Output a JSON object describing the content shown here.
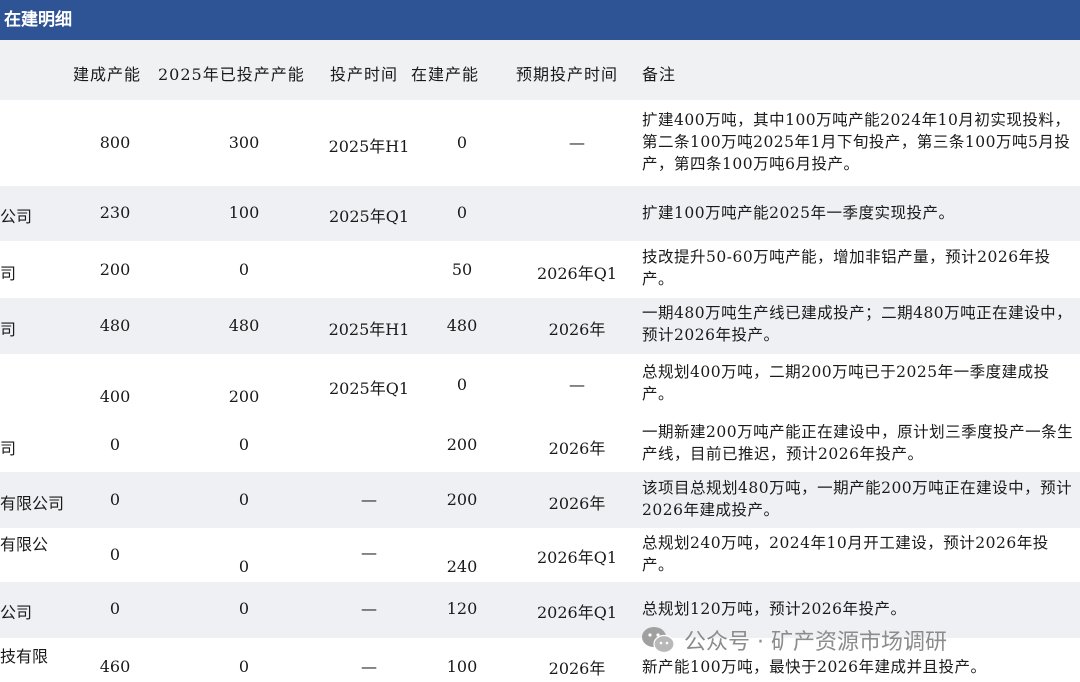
{
  "title": "在建明细",
  "headers": {
    "built": "建成产能",
    "commissioned_2025": "2025年已投产产能",
    "commission_time": "投产时间",
    "under_construction": "在建产能",
    "expected_time": "预期投产时间",
    "notes": "备注"
  },
  "rows": [
    {
      "name": "",
      "built": "800",
      "commissioned_2025": "300",
      "commission_time": "2025年H1",
      "under_construction": "0",
      "expected_time": "—",
      "notes": "扩建400万吨，其中100万吨产能2024年10月初实现投料，第二条100万吨2025年1月下旬投产，第三条100万吨5月投产，第四条100万吨6月投产。"
    },
    {
      "name": "公司",
      "built": "230",
      "commissioned_2025": "100",
      "commission_time": "2025年Q1",
      "under_construction": "0",
      "expected_time": "",
      "notes": "扩建100万吨产能2025年一季度实现投产。"
    },
    {
      "name": "司",
      "built": "200",
      "commissioned_2025": "0",
      "commission_time": "",
      "under_construction": "50",
      "expected_time": "2026年Q1",
      "notes": "技改提升50-60万吨产能，增加非铝产量，预计2026年投产。"
    },
    {
      "name": "司",
      "built": "480",
      "commissioned_2025": "480",
      "commission_time": "2025年H1",
      "under_construction": "480",
      "expected_time": "2026年",
      "notes": "一期480万吨生产线已建成投产；二期480万吨正在建设中，预计2026年投产。"
    },
    {
      "name": "",
      "built": "400",
      "commissioned_2025": "200",
      "commission_time": "2025年Q1",
      "under_construction": "0",
      "expected_time": "—",
      "notes": "总规划400万吨，二期200万吨已于2025年一季度建成投产。"
    },
    {
      "name": "司",
      "built": "0",
      "commissioned_2025": "0",
      "commission_time": "",
      "under_construction": "200",
      "expected_time": "2026年",
      "notes": "一期新建200万吨产能正在建设中，原计划三季度投产一条生产线，目前已推迟，预计2026年投产。"
    },
    {
      "name": "有限公司",
      "built": "0",
      "commissioned_2025": "0",
      "commission_time": "—",
      "under_construction": "200",
      "expected_time": "2026年",
      "notes": "该项目总规划480万吨，一期产能200万吨正在建设中，预计2026年建成投产。"
    },
    {
      "name": "有限公",
      "built": "0",
      "commissioned_2025": "0",
      "commission_time": "—",
      "under_construction": "240",
      "expected_time": "2026年Q1",
      "notes": "总规划240万吨，2024年10月开工建设，预计2026年投产。"
    },
    {
      "name": "公司",
      "built": "0",
      "commissioned_2025": "0",
      "commission_time": "—",
      "under_construction": "120",
      "expected_time": "2026年Q1",
      "notes": "总规划120万吨，预计2026年投产。"
    },
    {
      "name": "技有限",
      "built": "460",
      "commissioned_2025": "0",
      "commission_time": "—",
      "under_construction": "100",
      "expected_time": "2026年",
      "notes": "新产能100万吨，最快于2026年建成并且投产。"
    }
  ],
  "watermark": {
    "text": "公众号 · 矿产资源市场调研",
    "icon": "wechat-icon"
  },
  "colors": {
    "title_bar": "#2f5496",
    "header_bg": "#f0f1f3",
    "alt_row_bg": "#eef0f3",
    "watermark": "#8c8c8c"
  }
}
